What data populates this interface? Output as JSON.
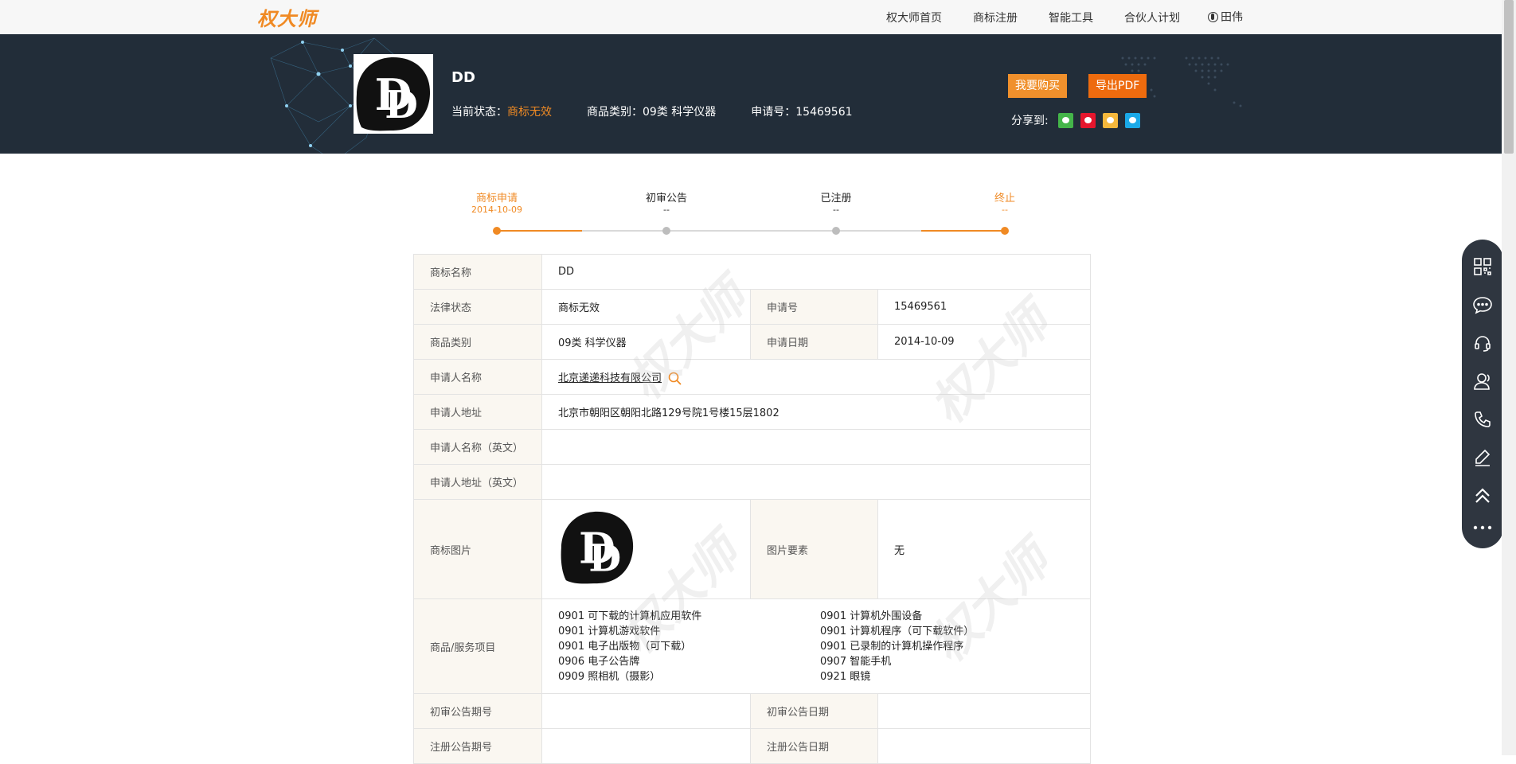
{
  "nav": {
    "logo": "权大师",
    "links": [
      "权大师首页",
      "商标注册",
      "智能工具",
      "合伙人计划"
    ],
    "user": "田伟"
  },
  "header": {
    "trademark_name": "DD",
    "status_label": "当前状态：",
    "status_value": "商标无效",
    "category_label": "商品类别：",
    "category_value": "09类 科学仪器",
    "appno_label": "申请号：",
    "appno_value": "15469561",
    "buy_button": "我要购买",
    "pdf_button": "导出PDF",
    "share_label": "分享到:"
  },
  "progress": [
    {
      "label": "商标申请",
      "date": "2014-10-09",
      "active": true
    },
    {
      "label": "初审公告",
      "date": "--",
      "active": false
    },
    {
      "label": "已注册",
      "date": "--",
      "active": false
    },
    {
      "label": "终止",
      "date": "--",
      "active": true
    }
  ],
  "details": {
    "name_label": "商标名称",
    "name_value": "DD",
    "legal_label": "法律状态",
    "legal_value": "商标无效",
    "appno_label": "申请号",
    "appno_value": "15469561",
    "category_label": "商品类别",
    "category_value": "09类 科学仪器",
    "appdate_label": "申请日期",
    "appdate_value": "2014-10-09",
    "applicant_label": "申请人名称",
    "applicant_value": "北京递递科技有限公司",
    "address_label": "申请人地址",
    "address_value": "北京市朝阳区朝阳北路129号院1号楼15层1802",
    "applicant_en_label": "申请人名称（英文）",
    "address_en_label": "申请人地址（英文）",
    "image_label": "商标图片",
    "elements_label": "图片要素",
    "elements_value": "无",
    "goods_label": "商品/服务项目",
    "goods": [
      "0901 可下载的计算机应用软件",
      "0901 计算机外围设备",
      "0901 计算机游戏软件",
      "0901 计算机程序（可下载软件）",
      "0901 电子出版物（可下载）",
      "0901 已录制的计算机操作程序",
      "0906 电子公告牌",
      "0907 智能手机",
      "0909 照相机（摄影）",
      "0921 眼镜"
    ],
    "prelim_no_label": "初审公告期号",
    "prelim_date_label": "初审公告日期",
    "reg_no_label": "注册公告期号",
    "reg_date_label": "注册公告日期"
  },
  "watermark": "权大师",
  "sidebar_icons": [
    "qrcode-icon",
    "chat-icon",
    "headset-icon",
    "contacts-icon",
    "phone-icon",
    "edit-icon",
    "back-to-top-icon",
    "more-icon"
  ]
}
